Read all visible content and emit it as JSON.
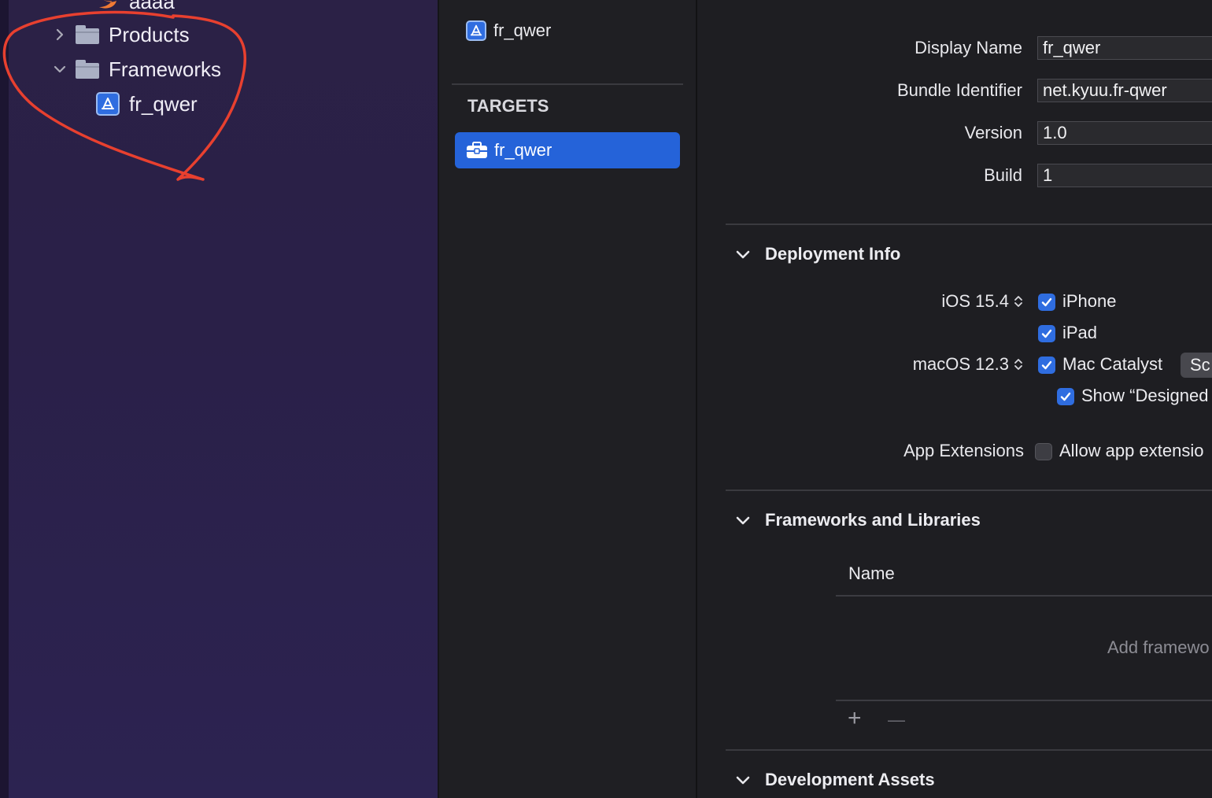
{
  "navigator": {
    "partial_item": "aaaa",
    "items": [
      {
        "label": "Products",
        "expanded": false
      },
      {
        "label": "Frameworks",
        "expanded": true
      },
      {
        "label": "fr_qwer"
      }
    ]
  },
  "project": {
    "name": "fr_qwer",
    "targets_header": "TARGETS",
    "targets": [
      {
        "label": "fr_qwer",
        "selected": true
      }
    ]
  },
  "identity": {
    "display_name_label": "Display Name",
    "display_name_value": "fr_qwer",
    "bundle_id_label": "Bundle Identifier",
    "bundle_id_value": "net.kyuu.fr-qwer",
    "version_label": "Version",
    "version_value": "1.0",
    "build_label": "Build",
    "build_value": "1"
  },
  "deployment": {
    "title": "Deployment Info",
    "ios_version": "iOS 15.4",
    "iphone": "iPhone",
    "ipad": "iPad",
    "macos_version": "macOS 12.3",
    "mac_catalyst": "Mac Catalyst",
    "catalyst_button": "Sc",
    "show_designed": "Show “Designed",
    "app_extensions_label": "App Extensions",
    "allow_app_extensions": "Allow app extensio"
  },
  "frameworks": {
    "title": "Frameworks and Libraries",
    "column_name": "Name",
    "empty_hint": "Add framewo",
    "add_symbol": "+",
    "remove_symbol": "—"
  },
  "dev_assets": {
    "title": "Development Assets"
  },
  "colors": {
    "accent": "#2f6de0",
    "annotation": "#e8402f"
  }
}
